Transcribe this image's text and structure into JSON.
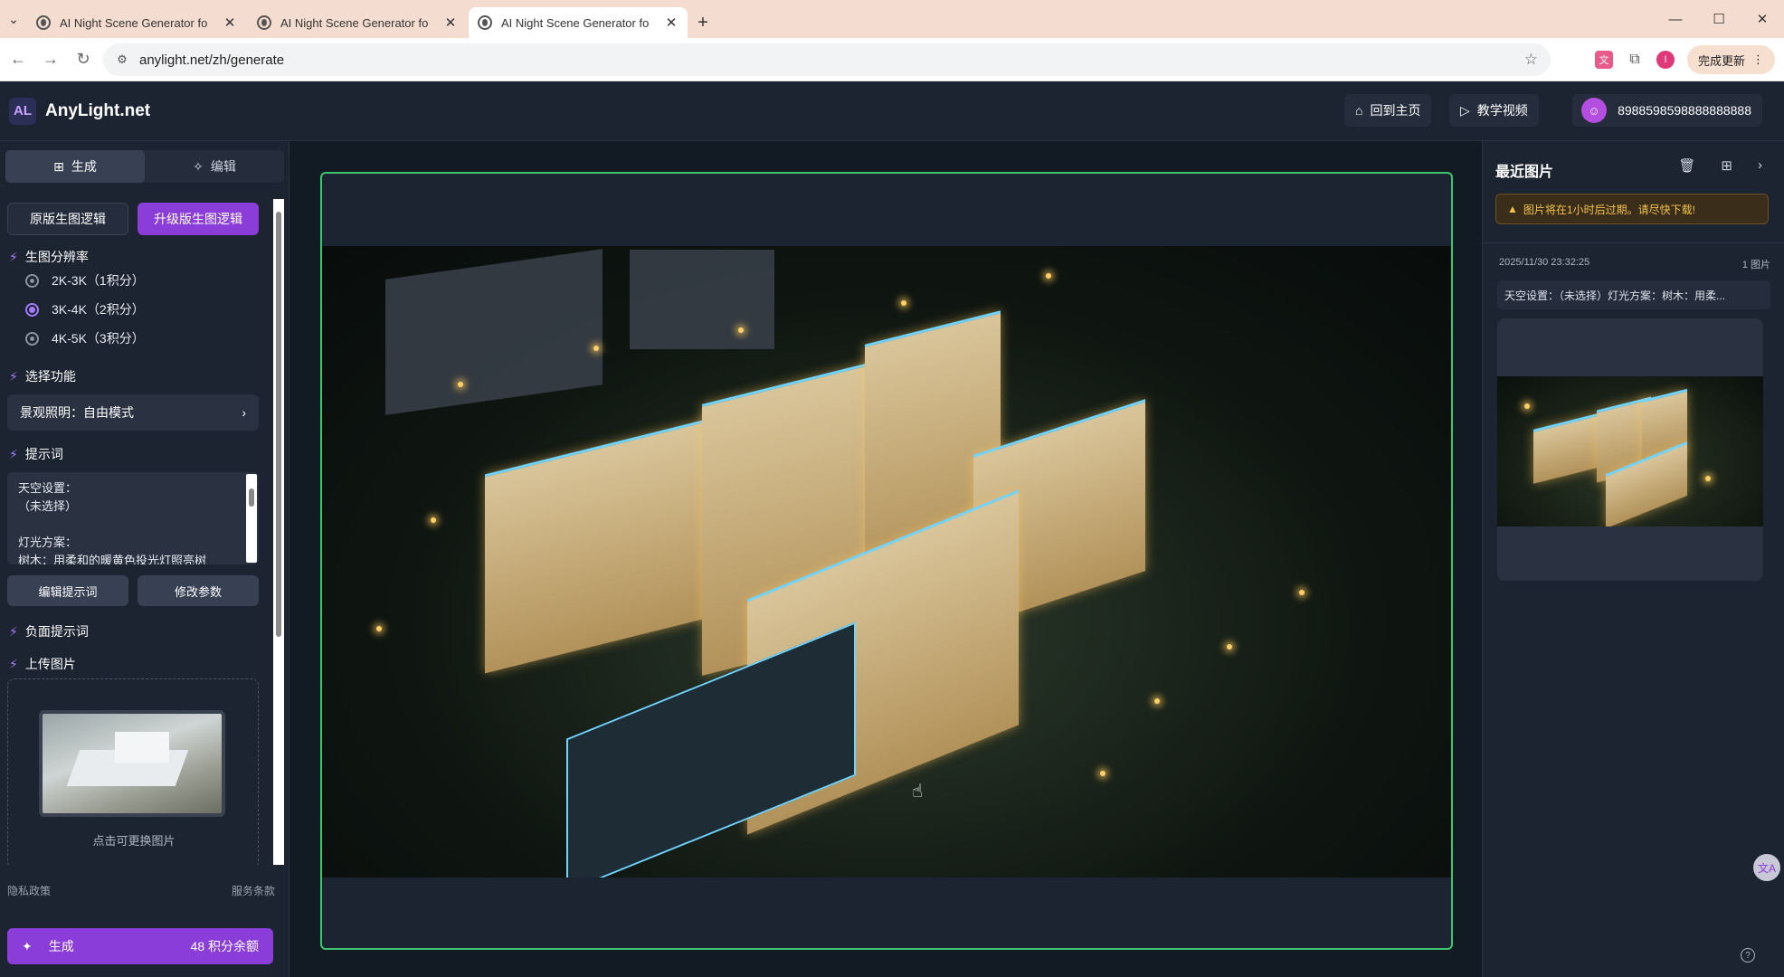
{
  "browser": {
    "tabs": [
      {
        "title": "AI Night Scene Generator fo",
        "active": false
      },
      {
        "title": "AI Night Scene Generator fo",
        "active": false
      },
      {
        "title": "AI Night Scene Generator fo",
        "active": true
      }
    ],
    "new_tab_icon": "plus-icon",
    "url": "anylight.net/zh/generate",
    "update_label": "完成更新",
    "profile_initial": "I"
  },
  "header": {
    "logo_text": "AL",
    "brand": "AnyLight.net",
    "home_label": "回到主页",
    "tutorial_label": "教学视频",
    "user_id": "8988598598888888888"
  },
  "sidebar": {
    "tabs": [
      {
        "label": "生成",
        "icon": "grid-icon",
        "active": true
      },
      {
        "label": "编辑",
        "icon": "magic-wand-icon",
        "active": false
      }
    ],
    "logic_buttons": [
      {
        "label": "原版生图逻辑",
        "active": false
      },
      {
        "label": "升级版生图逻辑",
        "active": true
      }
    ],
    "resolution_title": "生图分辨率",
    "resolutions": [
      {
        "label": "2K-3K（1积分）",
        "selected": false
      },
      {
        "label": "3K-4K（2积分）",
        "selected": true
      },
      {
        "label": "4K-5K（3积分）",
        "selected": false
      }
    ],
    "function_title": "选择功能",
    "function_value": "景观照明：自由模式",
    "prompt_title": "提示词",
    "prompt_text": "天空设置：\n（未选择）\n\n灯光方案：\n树木：用柔和的暖黄色投光灯照亮树",
    "edit_prompt_label": "编辑提示词",
    "modify_params_label": "修改参数",
    "negative_title": "负面提示词",
    "upload_title": "上传图片",
    "upload_hint": "点击可更换图片",
    "privacy": "隐私政策",
    "terms": "服务条款",
    "generate_label": "生成",
    "credits_label": "48 积分余额"
  },
  "recent": {
    "title": "最近图片",
    "warning": "图片将在1小时后过期。请尽快下载!",
    "timestamp": "2025/11/30 23:32:25",
    "count": "1 图片",
    "description": "天空设置：（未选择）灯光方案：树木：用柔...",
    "translate_label": "文A"
  },
  "colors": {
    "accent": "#8b3dd9",
    "frame_border": "#3fc56d",
    "warning": "#f2c24a"
  }
}
